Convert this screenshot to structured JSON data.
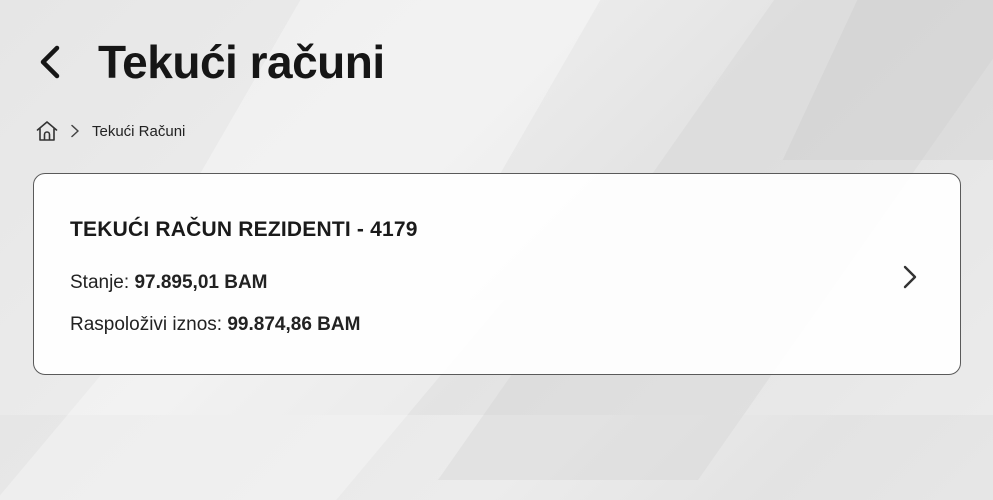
{
  "header": {
    "title": "Tekući računi"
  },
  "breadcrumb": {
    "current": "Tekući Računi"
  },
  "account": {
    "name": "TEKUĆI RAČUN REZIDENTI - 4179",
    "balance_label": "Stanje:",
    "balance_value": "97.895,01 BAM",
    "available_label": "Raspoloživi iznos:",
    "available_value": "99.874,86 BAM"
  },
  "icons": {
    "back": "chevron-left-icon",
    "home": "home-icon",
    "separator": "chevron-right-icon",
    "open": "chevron-right-icon"
  }
}
